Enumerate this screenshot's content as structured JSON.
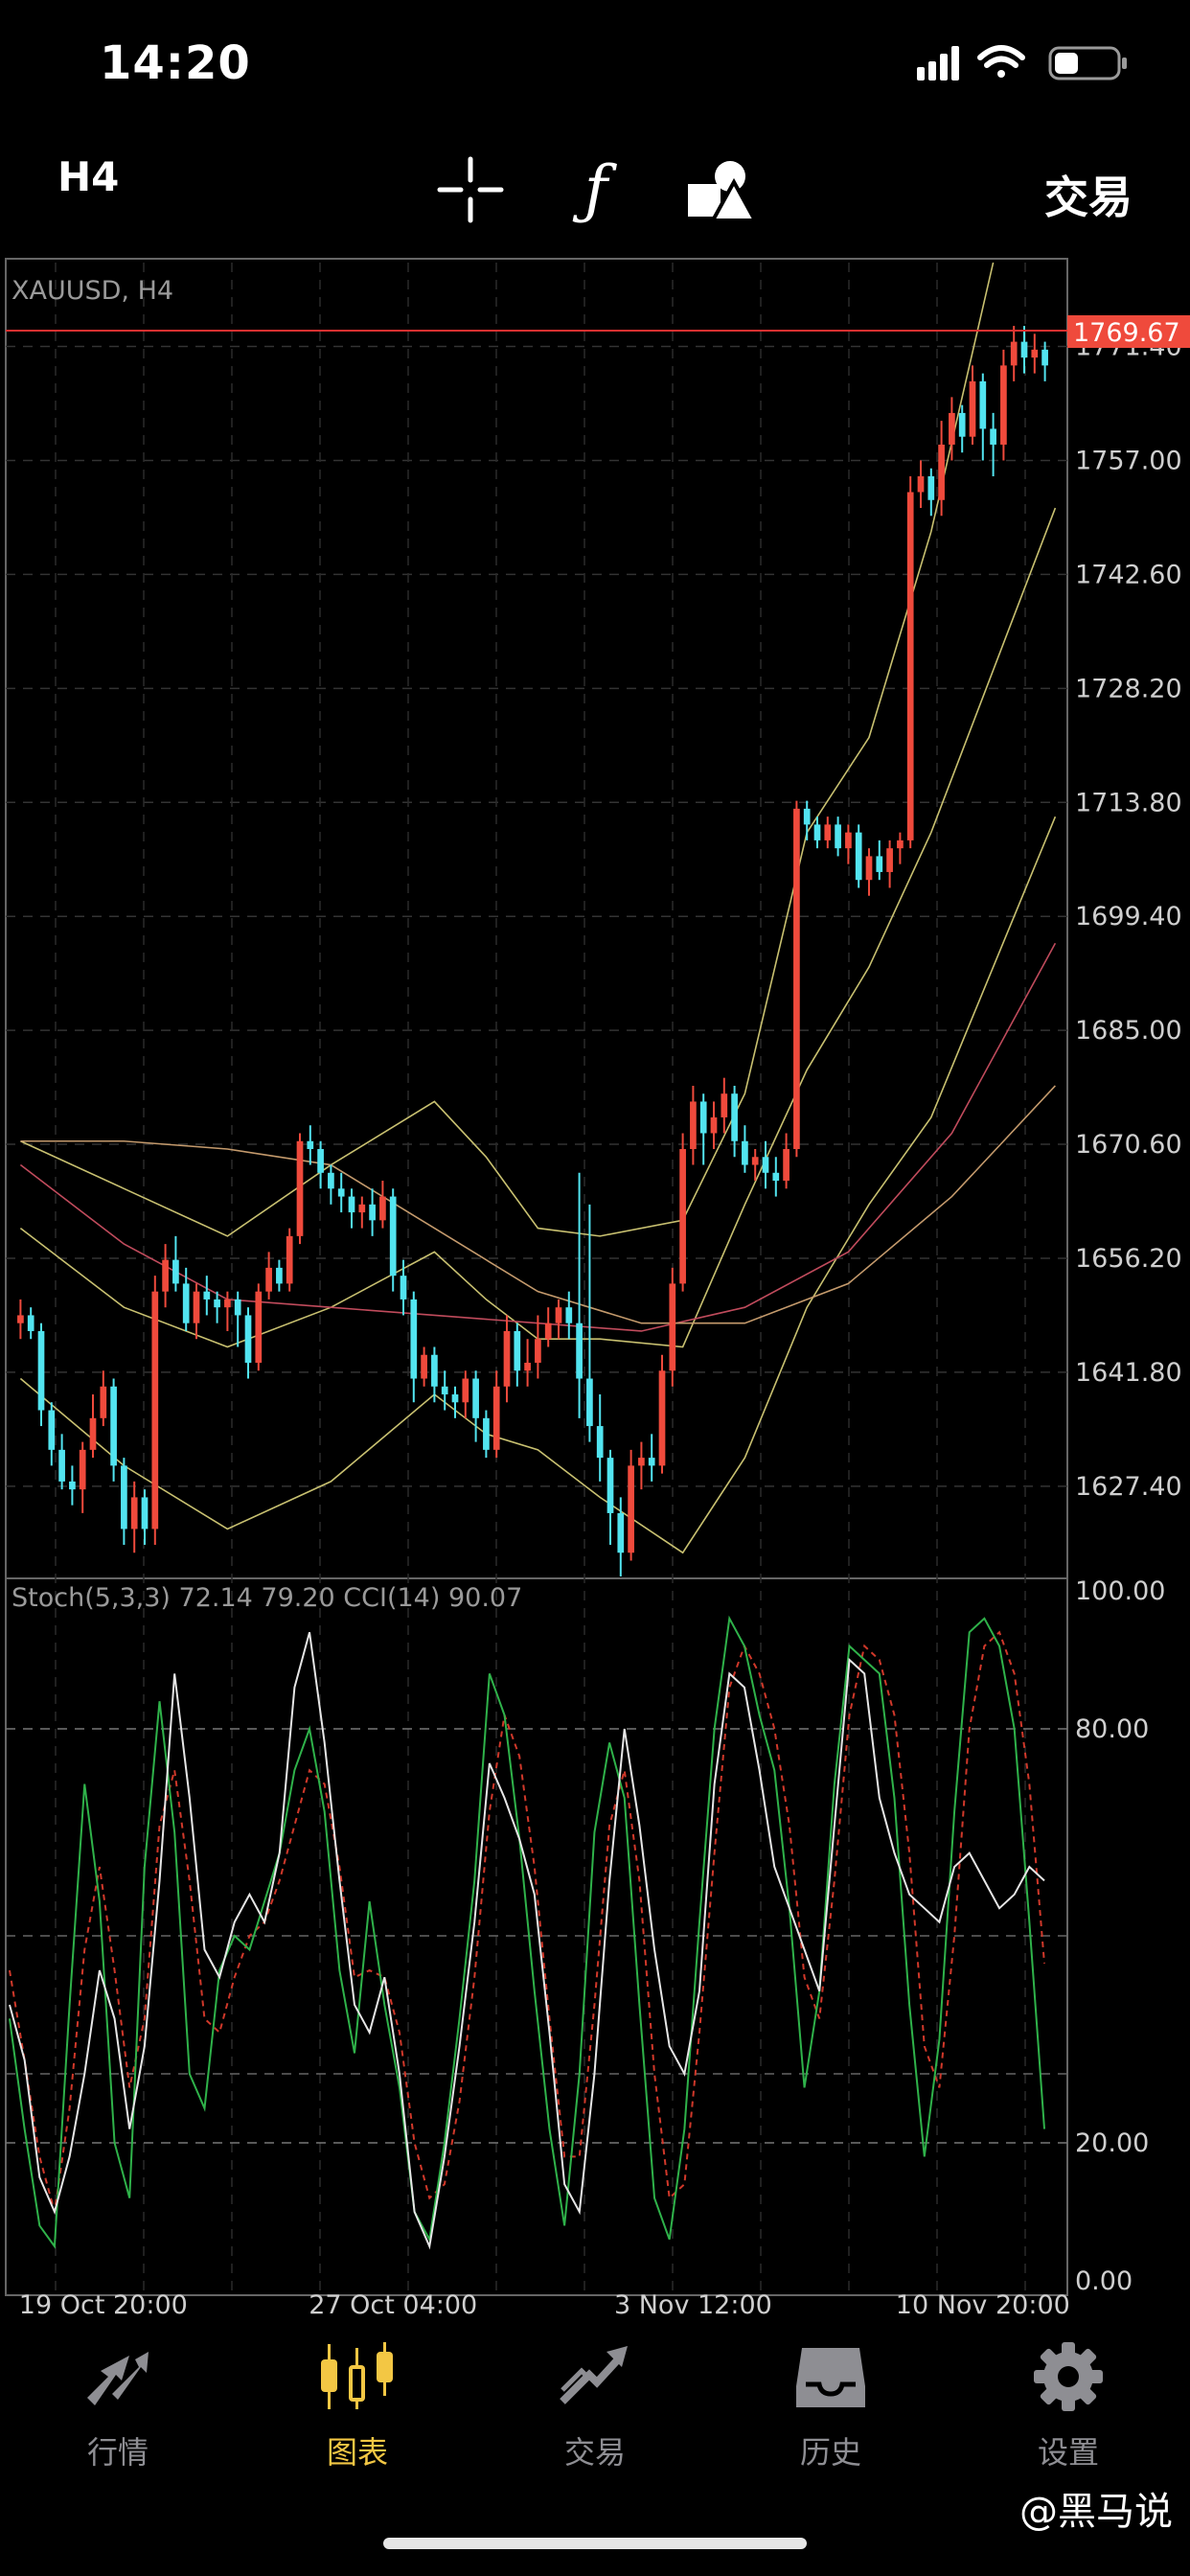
{
  "status_bar": {
    "time": "14:20"
  },
  "toolbar": {
    "timeframe": "H4",
    "indicator_glyph": "ƒ",
    "trade_label": "交易",
    "icons": [
      "crosshair-icon",
      "function-icon",
      "shapes-icon"
    ]
  },
  "chart": {
    "symbol_label": "XAUUSD, H4",
    "current_price": "1769.67",
    "price_ticks": [
      "1771.40",
      "1757.00",
      "1742.60",
      "1728.20",
      "1713.80",
      "1699.40",
      "1685.00",
      "1670.60",
      "1656.20",
      "1641.80",
      "1627.40"
    ],
    "time_labels": [
      "19 Oct 20:00",
      "27 Oct 04:00",
      "3 Nov 12:00",
      "10 Nov 20:00"
    ],
    "oscillator_label": "Stoch(5,3,3) 72.14 79.20 CCI(14) 90.07",
    "oscillator_ticks": [
      "100.00",
      "80.00",
      "20.00",
      "0.00"
    ],
    "colors": {
      "bull": "#ef4a3c",
      "bear": "#52e4f0",
      "bollinger": "#c8c070",
      "ma": "#c04b5c",
      "stoch_main": "#2fb24a",
      "stoch_signal": "#d0382a",
      "cci": "#e6e6e6",
      "price_line": "#e03030",
      "price_tag": "#ef4a3c"
    }
  },
  "chart_data": {
    "type": "candlestick",
    "title": "XAUUSD, H4",
    "y_range": [
      1616,
      1782
    ],
    "candles": [
      [
        1648,
        1649,
        1646,
        1651
      ],
      [
        1649,
        1647,
        1646,
        1650
      ],
      [
        1647,
        1637,
        1635,
        1648
      ],
      [
        1637,
        1632,
        1630,
        1638
      ],
      [
        1632,
        1628,
        1627,
        1634
      ],
      [
        1628,
        1627,
        1625,
        1630
      ],
      [
        1627,
        1632,
        1624,
        1633
      ],
      [
        1632,
        1636,
        1631,
        1639
      ],
      [
        1636,
        1640,
        1635,
        1642
      ],
      [
        1640,
        1630,
        1628,
        1641
      ],
      [
        1630,
        1622,
        1620,
        1631
      ],
      [
        1622,
        1626,
        1619,
        1628
      ],
      [
        1626,
        1622,
        1620,
        1627
      ],
      [
        1622,
        1652,
        1620,
        1654
      ],
      [
        1652,
        1656,
        1650,
        1658
      ],
      [
        1656,
        1653,
        1652,
        1659
      ],
      [
        1653,
        1648,
        1647,
        1655
      ],
      [
        1648,
        1652,
        1646,
        1653
      ],
      [
        1652,
        1651,
        1649,
        1654
      ],
      [
        1651,
        1650,
        1648,
        1652
      ],
      [
        1650,
        1651,
        1647,
        1652
      ],
      [
        1651,
        1649,
        1645,
        1652
      ],
      [
        1649,
        1643,
        1641,
        1650
      ],
      [
        1643,
        1652,
        1642,
        1653
      ],
      [
        1652,
        1655,
        1651,
        1657
      ],
      [
        1655,
        1653,
        1652,
        1656
      ],
      [
        1653,
        1659,
        1652,
        1660
      ],
      [
        1659,
        1671,
        1658,
        1672
      ],
      [
        1671,
        1670,
        1668,
        1673
      ],
      [
        1670,
        1667,
        1665,
        1671
      ],
      [
        1667,
        1665,
        1663,
        1668
      ],
      [
        1665,
        1664,
        1662,
        1667
      ],
      [
        1664,
        1662,
        1660,
        1665
      ],
      [
        1662,
        1663,
        1660,
        1664
      ],
      [
        1663,
        1661,
        1659,
        1665
      ],
      [
        1661,
        1664,
        1660,
        1666
      ],
      [
        1664,
        1654,
        1652,
        1665
      ],
      [
        1654,
        1651,
        1649,
        1656
      ],
      [
        1651,
        1641,
        1638,
        1652
      ],
      [
        1641,
        1644,
        1640,
        1645
      ],
      [
        1644,
        1640,
        1638,
        1645
      ],
      [
        1640,
        1639,
        1637,
        1642
      ],
      [
        1639,
        1638,
        1636,
        1640
      ],
      [
        1638,
        1641,
        1636,
        1642
      ],
      [
        1641,
        1636,
        1633,
        1642
      ],
      [
        1636,
        1632,
        1631,
        1637
      ],
      [
        1632,
        1640,
        1631,
        1642
      ],
      [
        1640,
        1647,
        1638,
        1649
      ],
      [
        1647,
        1642,
        1640,
        1648
      ],
      [
        1642,
        1643,
        1640,
        1646
      ],
      [
        1643,
        1646,
        1641,
        1649
      ],
      [
        1646,
        1648,
        1645,
        1650
      ],
      [
        1648,
        1650,
        1646,
        1651
      ],
      [
        1650,
        1648,
        1646,
        1652
      ],
      [
        1648,
        1641,
        1636,
        1667
      ],
      [
        1641,
        1635,
        1633,
        1663
      ],
      [
        1635,
        1631,
        1628,
        1639
      ],
      [
        1631,
        1624,
        1620,
        1632
      ],
      [
        1624,
        1619,
        1616,
        1626
      ],
      [
        1619,
        1630,
        1618,
        1632
      ],
      [
        1630,
        1631,
        1627,
        1633
      ],
      [
        1631,
        1630,
        1628,
        1634
      ],
      [
        1630,
        1642,
        1629,
        1644
      ],
      [
        1642,
        1653,
        1640,
        1655
      ],
      [
        1653,
        1670,
        1652,
        1672
      ],
      [
        1670,
        1676,
        1668,
        1678
      ],
      [
        1676,
        1672,
        1668,
        1677
      ],
      [
        1672,
        1674,
        1670,
        1676
      ],
      [
        1674,
        1677,
        1672,
        1679
      ],
      [
        1677,
        1671,
        1669,
        1678
      ],
      [
        1671,
        1668,
        1667,
        1673
      ],
      [
        1668,
        1669,
        1666,
        1670
      ],
      [
        1669,
        1667,
        1665,
        1671
      ],
      [
        1667,
        1666,
        1664,
        1669
      ],
      [
        1666,
        1670,
        1665,
        1672
      ],
      [
        1670,
        1713,
        1669,
        1714
      ],
      [
        1713,
        1711,
        1709,
        1714
      ],
      [
        1711,
        1709,
        1708,
        1712
      ],
      [
        1709,
        1711,
        1708,
        1712
      ],
      [
        1711,
        1708,
        1707,
        1712
      ],
      [
        1708,
        1710,
        1706,
        1711
      ],
      [
        1710,
        1704,
        1703,
        1711
      ],
      [
        1704,
        1707,
        1702,
        1708
      ],
      [
        1707,
        1705,
        1704,
        1709
      ],
      [
        1705,
        1708,
        1703,
        1709
      ],
      [
        1708,
        1709,
        1706,
        1710
      ],
      [
        1709,
        1753,
        1708,
        1755
      ],
      [
        1753,
        1755,
        1751,
        1757
      ],
      [
        1755,
        1752,
        1750,
        1756
      ],
      [
        1752,
        1759,
        1750,
        1762
      ],
      [
        1759,
        1763,
        1757,
        1765
      ],
      [
        1763,
        1760,
        1758,
        1764
      ],
      [
        1760,
        1767,
        1759,
        1769
      ],
      [
        1767,
        1761,
        1757,
        1768
      ],
      [
        1761,
        1759,
        1755,
        1763
      ],
      [
        1759,
        1769,
        1757,
        1771
      ],
      [
        1769,
        1772,
        1767,
        1774
      ],
      [
        1772,
        1770,
        1768,
        1774
      ],
      [
        1770,
        1771,
        1768,
        1773
      ],
      [
        1771,
        1769,
        1767,
        1772
      ]
    ],
    "bollinger_upper": [
      [
        0,
        1671
      ],
      [
        10,
        1665
      ],
      [
        20,
        1659
      ],
      [
        30,
        1668
      ],
      [
        40,
        1676
      ],
      [
        45,
        1669
      ],
      [
        50,
        1660
      ],
      [
        56,
        1659
      ],
      [
        64,
        1661
      ],
      [
        70,
        1677
      ],
      [
        76,
        1710
      ],
      [
        82,
        1722
      ],
      [
        88,
        1748
      ],
      [
        94,
        1782
      ]
    ],
    "bollinger_middle": [
      [
        0,
        1660
      ],
      [
        10,
        1650
      ],
      [
        20,
        1645
      ],
      [
        30,
        1650
      ],
      [
        40,
        1657
      ],
      [
        45,
        1651
      ],
      [
        50,
        1646
      ],
      [
        56,
        1646
      ],
      [
        64,
        1645
      ],
      [
        70,
        1663
      ],
      [
        76,
        1680
      ],
      [
        82,
        1693
      ],
      [
        88,
        1710
      ],
      [
        100,
        1751
      ]
    ],
    "bollinger_lower": [
      [
        0,
        1641
      ],
      [
        10,
        1630
      ],
      [
        20,
        1622
      ],
      [
        30,
        1628
      ],
      [
        40,
        1639
      ],
      [
        45,
        1634
      ],
      [
        50,
        1632
      ],
      [
        56,
        1626
      ],
      [
        64,
        1619
      ],
      [
        70,
        1631
      ],
      [
        76,
        1650
      ],
      [
        82,
        1663
      ],
      [
        88,
        1674
      ],
      [
        100,
        1712
      ]
    ],
    "ma_slow": [
      [
        0,
        1668
      ],
      [
        10,
        1658
      ],
      [
        20,
        1651
      ],
      [
        30,
        1650
      ],
      [
        40,
        1649
      ],
      [
        50,
        1648
      ],
      [
        60,
        1647
      ],
      [
        70,
        1650
      ],
      [
        80,
        1657
      ],
      [
        90,
        1672
      ],
      [
        100,
        1696
      ]
    ],
    "ma_fast": [
      [
        0,
        1671
      ],
      [
        10,
        1671
      ],
      [
        20,
        1670
      ],
      [
        30,
        1668
      ],
      [
        40,
        1660
      ],
      [
        50,
        1652
      ],
      [
        60,
        1648
      ],
      [
        70,
        1648
      ],
      [
        80,
        1653
      ],
      [
        90,
        1664
      ],
      [
        100,
        1678
      ]
    ],
    "stoch_main": [
      38,
      22,
      8,
      5,
      40,
      72,
      55,
      20,
      12,
      60,
      84,
      65,
      30,
      25,
      45,
      50,
      48,
      55,
      62,
      74,
      80,
      68,
      45,
      33,
      55,
      40,
      28,
      10,
      6,
      20,
      38,
      58,
      88,
      82,
      64,
      42,
      22,
      8,
      30,
      65,
      78,
      70,
      40,
      12,
      6,
      22,
      52,
      80,
      96,
      92,
      82,
      74,
      54,
      28,
      42,
      72,
      92,
      90,
      88,
      70,
      40,
      18,
      35,
      68,
      94,
      96,
      92,
      80,
      52,
      22
    ],
    "stoch_signal": [
      45,
      32,
      18,
      10,
      25,
      48,
      60,
      45,
      28,
      38,
      66,
      74,
      58,
      38,
      36,
      44,
      50,
      52,
      58,
      66,
      74,
      72,
      60,
      44,
      45,
      44,
      36,
      20,
      12,
      14,
      26,
      44,
      68,
      82,
      76,
      60,
      38,
      18,
      18,
      40,
      66,
      74,
      58,
      30,
      12,
      14,
      36,
      62,
      86,
      92,
      88,
      80,
      66,
      44,
      38,
      58,
      82,
      92,
      90,
      82,
      62,
      34,
      28,
      50,
      80,
      92,
      94,
      88,
      72,
      46
    ],
    "cci_normalized": [
      40,
      32,
      15,
      10,
      18,
      30,
      45,
      38,
      22,
      34,
      58,
      88,
      70,
      48,
      44,
      52,
      56,
      52,
      62,
      86,
      94,
      78,
      58,
      40,
      36,
      44,
      30,
      10,
      5,
      18,
      34,
      52,
      75,
      70,
      64,
      56,
      36,
      14,
      10,
      30,
      58,
      80,
      66,
      48,
      34,
      30,
      42,
      72,
      88,
      86,
      74,
      60,
      54,
      48,
      42,
      66,
      90,
      88,
      70,
      62,
      56,
      54,
      52,
      60,
      62,
      58,
      54,
      56,
      60,
      58
    ],
    "oscillator_range": [
      0,
      100
    ]
  },
  "tab_bar": {
    "tabs": [
      {
        "label": "行情",
        "icon": "quotes-icon"
      },
      {
        "label": "图表",
        "icon": "chart-icon"
      },
      {
        "label": "交易",
        "icon": "trade-icon"
      },
      {
        "label": "历史",
        "icon": "history-icon"
      },
      {
        "label": "设置",
        "icon": "settings-icon"
      }
    ]
  },
  "watermark": "@黑马说"
}
